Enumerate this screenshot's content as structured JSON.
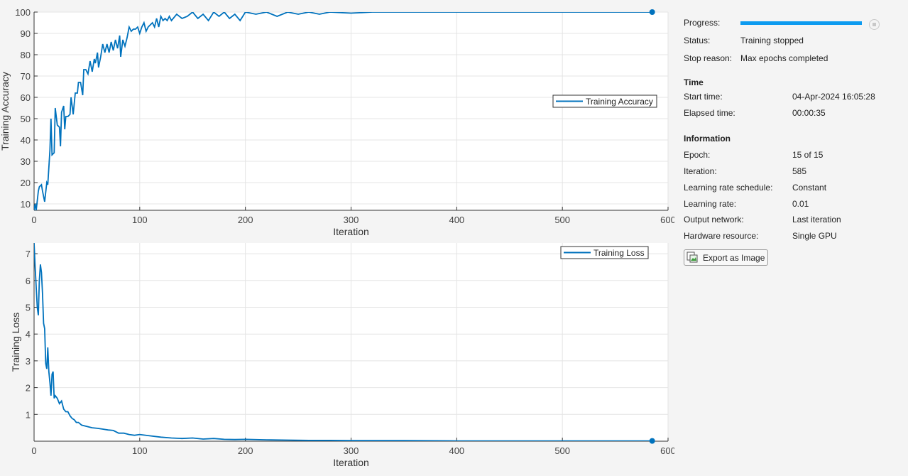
{
  "chart_data": [
    {
      "type": "line",
      "title": "",
      "xlabel": "Iteration",
      "ylabel": "Training Accuracy",
      "xlim": [
        0,
        600
      ],
      "ylim": [
        7,
        100
      ],
      "xticks": [
        0,
        100,
        200,
        300,
        400,
        500,
        600
      ],
      "yticks": [
        10,
        20,
        30,
        40,
        50,
        60,
        70,
        80,
        90,
        100
      ],
      "grid": true,
      "legend": {
        "entries": [
          "Training Accuracy"
        ],
        "placement": "right"
      },
      "series": [
        {
          "name": "Training Accuracy",
          "color": "#0072bd",
          "x": [
            0,
            1,
            2,
            4,
            5,
            7,
            8,
            10,
            12,
            13,
            15,
            16,
            17,
            19,
            20,
            22,
            24,
            25,
            26,
            28,
            29,
            30,
            32,
            34,
            35,
            37,
            39,
            41,
            42,
            44,
            46,
            47,
            49,
            51,
            53,
            55,
            57,
            58,
            60,
            61,
            63,
            65,
            67,
            69,
            71,
            73,
            75,
            77,
            79,
            81,
            82,
            84,
            86,
            88,
            90,
            92,
            94,
            96,
            98,
            100,
            102,
            104,
            106,
            108,
            110,
            112,
            114,
            116,
            118,
            120,
            122,
            124,
            126,
            128,
            130,
            135,
            140,
            145,
            150,
            155,
            160,
            165,
            170,
            175,
            180,
            185,
            190,
            195,
            200,
            210,
            220,
            230,
            240,
            250,
            260,
            270,
            280,
            300,
            320,
            350,
            390,
            430,
            500,
            585
          ],
          "y": [
            7,
            10,
            7,
            16,
            18,
            19,
            16,
            11,
            20,
            19,
            35,
            50,
            33,
            34,
            55,
            47,
            46,
            37,
            53,
            56,
            45,
            51,
            51,
            52,
            60,
            52,
            62,
            62,
            67,
            67,
            61,
            73,
            73,
            71,
            77,
            72,
            78,
            76,
            81,
            74,
            79,
            85,
            81,
            85,
            81,
            86,
            82,
            87,
            83,
            89,
            79,
            87,
            84,
            88,
            93,
            91,
            92,
            92,
            93,
            90,
            93,
            95,
            91,
            93,
            94,
            95,
            93,
            97,
            93,
            98,
            96,
            97,
            96,
            98,
            96,
            99,
            97,
            98,
            100,
            97,
            99,
            96,
            100,
            98,
            100,
            97,
            99,
            96,
            100,
            99,
            100,
            98,
            100,
            99,
            100,
            99,
            100,
            99.5,
            100,
            100,
            100,
            100,
            100,
            100
          ]
        }
      ],
      "final_marker": {
        "x": 585,
        "y": 100
      }
    },
    {
      "type": "line",
      "title": "",
      "xlabel": "Iteration",
      "ylabel": "Training Loss",
      "xlim": [
        0,
        600
      ],
      "ylim": [
        0,
        7.4
      ],
      "xticks": [
        0,
        100,
        200,
        300,
        400,
        500,
        600
      ],
      "yticks": [
        1,
        2,
        3,
        4,
        5,
        6,
        7
      ],
      "grid": true,
      "legend": {
        "entries": [
          "Training Loss"
        ],
        "placement": "top-right"
      },
      "series": [
        {
          "name": "Training Loss",
          "color": "#0072bd",
          "x": [
            0,
            1,
            3,
            4,
            5,
            6,
            7,
            8,
            9,
            10,
            11,
            12,
            13,
            14,
            15,
            16,
            17,
            18,
            19,
            20,
            22,
            24,
            26,
            28,
            30,
            32,
            34,
            36,
            38,
            40,
            42,
            45,
            50,
            55,
            60,
            65,
            70,
            75,
            80,
            85,
            90,
            95,
            100,
            110,
            120,
            130,
            140,
            150,
            160,
            170,
            180,
            190,
            200,
            220,
            240,
            260,
            280,
            300,
            350,
            400,
            500,
            585
          ],
          "y": [
            7.4,
            6.5,
            5.0,
            4.7,
            6.0,
            6.6,
            6.3,
            5.5,
            4.4,
            4.2,
            2.9,
            2.7,
            3.5,
            2.6,
            2.2,
            1.7,
            2.5,
            2.6,
            1.6,
            1.7,
            1.6,
            1.4,
            1.5,
            1.2,
            1.1,
            1.1,
            0.95,
            0.85,
            0.8,
            0.7,
            0.7,
            0.6,
            0.55,
            0.5,
            0.48,
            0.45,
            0.42,
            0.4,
            0.3,
            0.3,
            0.25,
            0.22,
            0.25,
            0.2,
            0.15,
            0.12,
            0.1,
            0.12,
            0.08,
            0.1,
            0.07,
            0.06,
            0.07,
            0.05,
            0.04,
            0.03,
            0.03,
            0.02,
            0.02,
            0.01,
            0.01,
            0.01
          ]
        }
      ],
      "final_marker": {
        "x": 585,
        "y": 0.01
      }
    }
  ],
  "panel": {
    "progress_label": "Progress:",
    "progress_fraction": 1.0,
    "status_label": "Status:",
    "status_value": "Training stopped",
    "stop_reason_label": "Stop reason:",
    "stop_reason_value": "Max epochs completed",
    "time_heading": "Time",
    "start_time_label": "Start time:",
    "start_time_value": "04-Apr-2024 16:05:28",
    "elapsed_label": "Elapsed time:",
    "elapsed_value": "00:00:35",
    "info_heading": "Information",
    "info": [
      {
        "label": "Epoch:",
        "value": "15 of 15"
      },
      {
        "label": "Iteration:",
        "value": "585"
      },
      {
        "label": "Learning rate schedule:",
        "value": "Constant"
      },
      {
        "label": "Learning rate:",
        "value": "0.01"
      },
      {
        "label": "Output network:",
        "value": "Last iteration"
      },
      {
        "label": "Hardware resource:",
        "value": "Single GPU"
      }
    ],
    "export_label": "Export as Image"
  }
}
